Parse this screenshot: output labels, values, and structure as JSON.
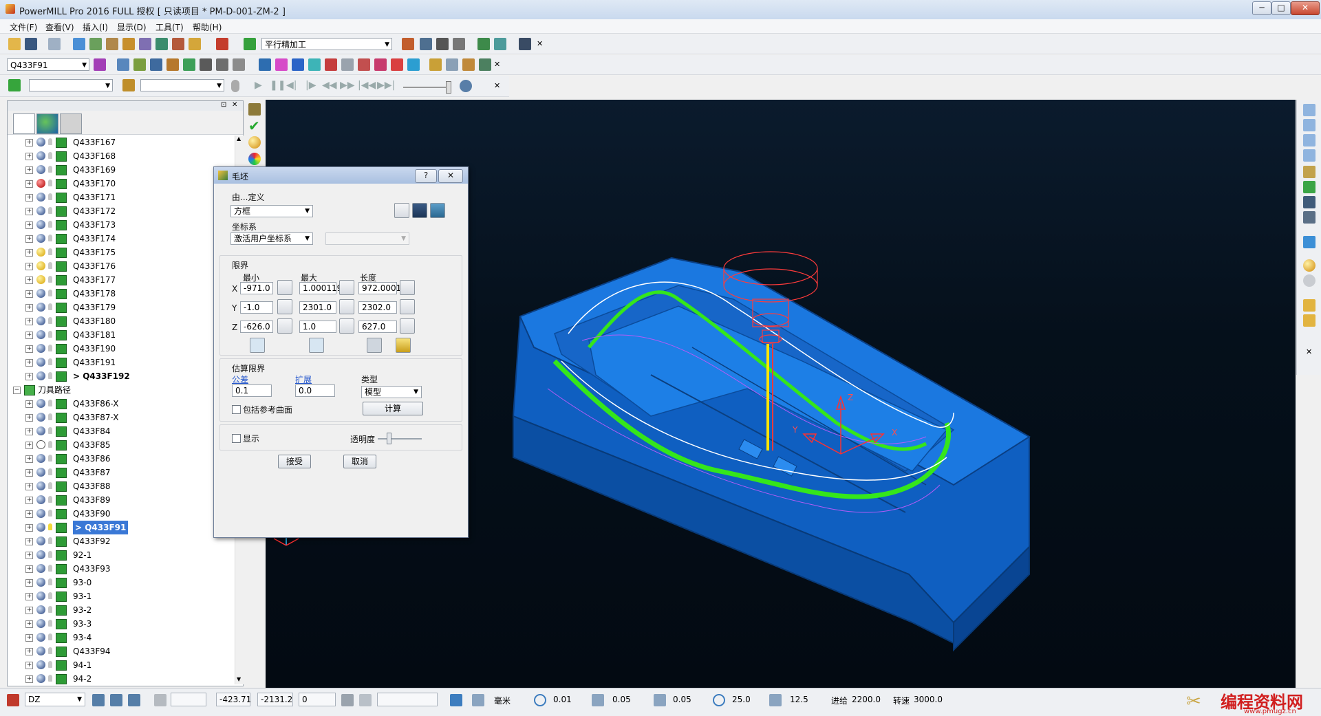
{
  "window": {
    "title": "PowerMILL Pro 2016 FULL 授权  [ 只读项目 * PM-D-001-ZM-2 ]",
    "controls": [
      "─",
      "□",
      "✕"
    ]
  },
  "menu": [
    "文件(F)",
    "查看(V)",
    "插入(I)",
    "显示(D)",
    "工具(T)",
    "帮助(H)"
  ],
  "toolbar1": {
    "strategy_combo": "平行精加工"
  },
  "toolbar2": {
    "toolpath_combo": "Q433F91"
  },
  "explorer": {
    "rows": [
      {
        "name": "Q433F167",
        "status": "ok",
        "bulb": false
      },
      {
        "name": "Q433F168",
        "status": "ok",
        "bulb": false
      },
      {
        "name": "Q433F169",
        "status": "ok",
        "bulb": false
      },
      {
        "name": "Q433F170",
        "status": "err",
        "bulb": false
      },
      {
        "name": "Q433F171",
        "status": "ok",
        "bulb": false
      },
      {
        "name": "Q433F172",
        "status": "ok",
        "bulb": false
      },
      {
        "name": "Q433F173",
        "status": "ok",
        "bulb": false
      },
      {
        "name": "Q433F174",
        "status": "ok",
        "bulb": false
      },
      {
        "name": "Q433F175",
        "status": "warn",
        "bulb": false
      },
      {
        "name": "Q433F176",
        "status": "warn",
        "bulb": false
      },
      {
        "name": "Q433F177",
        "status": "warn",
        "bulb": false
      },
      {
        "name": "Q433F178",
        "status": "ok",
        "bulb": false
      },
      {
        "name": "Q433F179",
        "status": "ok",
        "bulb": false
      },
      {
        "name": "Q433F180",
        "status": "ok",
        "bulb": false
      },
      {
        "name": "Q433F181",
        "status": "ok",
        "bulb": false
      },
      {
        "name": "Q433F190",
        "status": "ok",
        "bulb": false
      },
      {
        "name": "Q433F191",
        "status": "ok",
        "bulb": false
      },
      {
        "name": "> Q433F192",
        "status": "ok",
        "bulb": false,
        "bold": true
      },
      {
        "name": "刀具路径",
        "folder": true
      },
      {
        "name": "Q433F86-X",
        "status": "ok",
        "bulb": false
      },
      {
        "name": "Q433F87-X",
        "status": "ok",
        "bulb": false
      },
      {
        "name": "Q433F84",
        "status": "ok",
        "bulb": false
      },
      {
        "name": "Q433F85",
        "status": "done",
        "bulb": false
      },
      {
        "name": "Q433F86",
        "status": "ok",
        "bulb": false
      },
      {
        "name": "Q433F87",
        "status": "ok",
        "bulb": false
      },
      {
        "name": "Q433F88",
        "status": "ok",
        "bulb": false
      },
      {
        "name": "Q433F89",
        "status": "ok",
        "bulb": false
      },
      {
        "name": "Q433F90",
        "status": "ok",
        "bulb": false
      },
      {
        "name": "> Q433F91",
        "status": "ok",
        "bulb": true,
        "selected": true
      },
      {
        "name": "Q433F92",
        "status": "ok",
        "bulb": false
      },
      {
        "name": "92-1",
        "status": "ok",
        "bulb": false
      },
      {
        "name": "Q433F93",
        "status": "ok",
        "bulb": false
      },
      {
        "name": "93-0",
        "status": "ok",
        "bulb": false
      },
      {
        "name": "93-1",
        "status": "ok",
        "bulb": false
      },
      {
        "name": "93-2",
        "status": "ok",
        "bulb": false
      },
      {
        "name": "93-3",
        "status": "ok",
        "bulb": false
      },
      {
        "name": "93-4",
        "status": "ok",
        "bulb": false
      },
      {
        "name": "Q433F94",
        "status": "ok",
        "bulb": false
      },
      {
        "name": "94-1",
        "status": "ok",
        "bulb": false
      },
      {
        "name": "94-2",
        "status": "ok",
        "bulb": false
      }
    ]
  },
  "dialog": {
    "title": "毛坯",
    "help": "?",
    "close": "✕",
    "defined_by_label": "由...定义",
    "defined_by_value": "方框",
    "coord_label": "坐标系",
    "coord_value": "激活用户坐标系",
    "limits_label": "限界",
    "col_min": "最小",
    "col_max": "最大",
    "col_len": "长度",
    "axes": [
      "X",
      "Y",
      "Z"
    ],
    "x": {
      "min": "-971.0",
      "max": "1.000119",
      "len": "972.0001"
    },
    "y": {
      "min": "-1.0",
      "max": "2301.0",
      "len": "2302.0"
    },
    "z": {
      "min": "-626.0",
      "max": "1.0",
      "len": "627.0"
    },
    "estimate_label": "估算限界",
    "tolerance_label": "公差",
    "tolerance_value": "0.1",
    "expand_label": "扩展",
    "expand_value": "0.0",
    "type_label": "类型",
    "type_value": "模型",
    "include_ref": "包括参考曲面",
    "calc_btn": "计算",
    "show_label": "显示",
    "transparency_label": "透明度",
    "transparency_value": 0.25,
    "accept_btn": "接受",
    "cancel_btn": "取消"
  },
  "viewport": {
    "axis_labels": {
      "x": "X",
      "y": "Y",
      "z": "Z"
    },
    "mini_axis": {
      "x": "X",
      "y": "Y",
      "z": "Z"
    }
  },
  "statusbar": {
    "workplane": "DZ",
    "coord_x": "-423.71",
    "coord_y": "-2131.2",
    "coord_z": "0",
    "unit": "毫米",
    "tol1": "0.01",
    "tol2": "0.05",
    "tol3": "0.05",
    "angle": "25.0",
    "step": "12.5",
    "feed_label": "进给",
    "feed_value": "2200.0",
    "speed_label": "转速",
    "speed_value": "3000.0",
    "watermark_main": "编程资料网",
    "watermark_url": "www.pmugz.cn"
  },
  "colors": {
    "part": "#1a6fd6",
    "toolpath": "#35e61b",
    "tool": "#ff3333",
    "viewport_bg": "#06111e"
  }
}
